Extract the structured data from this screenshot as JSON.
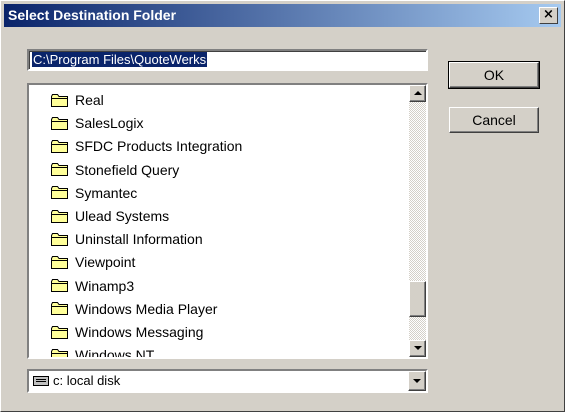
{
  "window": {
    "title": "Select Destination Folder",
    "close_label": "×"
  },
  "path": {
    "value": "C:\\Program Files\\QuoteWerks"
  },
  "buttons": {
    "ok": "OK",
    "cancel": "Cancel"
  },
  "folders": [
    "Real",
    "SalesLogix",
    "SFDC Products Integration",
    "Stonefield Query",
    "Symantec",
    "Ulead Systems",
    "Uninstall Information",
    "Viewpoint",
    "Winamp3",
    "Windows Media Player",
    "Windows Messaging",
    "Windows NT"
  ],
  "drive": {
    "selected": "c:  local disk"
  },
  "icons": {
    "folder": "folder-icon",
    "drive": "hard-drive-icon"
  },
  "colors": {
    "titlebar_start": "#0a246a",
    "titlebar_end": "#a6caf0",
    "selection": "#0a246a",
    "folder_fill": "#ffff99"
  }
}
